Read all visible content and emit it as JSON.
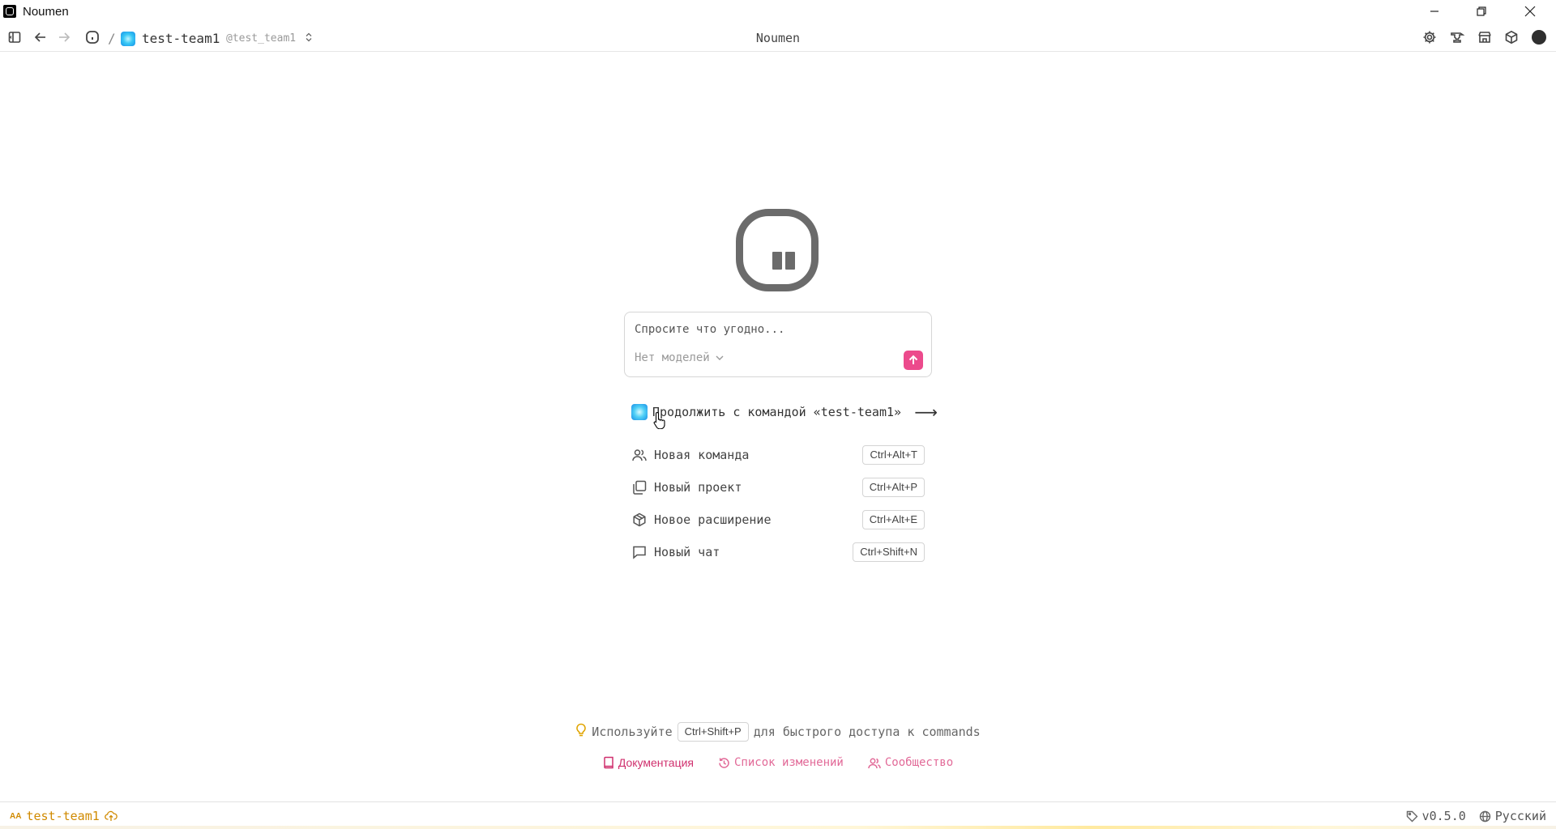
{
  "window": {
    "title": "Noumen"
  },
  "toolbar": {
    "center_title": "Noumen",
    "separator": "/",
    "team_name": "test-team1",
    "team_handle": "@test_team1"
  },
  "prompt": {
    "placeholder": "Спросите что угодно...",
    "model_label": "Нет моделей"
  },
  "continue": {
    "label": "Продолжить с командой «test-team1»",
    "arrow": "⟶"
  },
  "actions": [
    {
      "label": "Новая команда",
      "shortcut": "Ctrl+Alt+T",
      "icon": "users-icon"
    },
    {
      "label": "Новый проект",
      "shortcut": "Ctrl+Alt+P",
      "icon": "folders-icon"
    },
    {
      "label": "Новое расширение",
      "shortcut": "Ctrl+Alt+E",
      "icon": "package-icon"
    },
    {
      "label": "Новый чат",
      "shortcut": "Ctrl+Shift+N",
      "icon": "chat-icon"
    }
  ],
  "tip": {
    "prefix": "Используйте",
    "shortcut": "Ctrl+Shift+P",
    "suffix": "для быстрого доступа к commands"
  },
  "links": {
    "docs": "Документация",
    "changelog": "Список изменений",
    "community": "Сообщество"
  },
  "statusbar": {
    "team_prefix": "AA",
    "team_name": "test-team1",
    "version": "v0.5.0",
    "language": "Русский"
  },
  "colors": {
    "accent": "#ec4a8c",
    "team_gradient": "#38c8f5",
    "status_team": "#d08a00"
  }
}
